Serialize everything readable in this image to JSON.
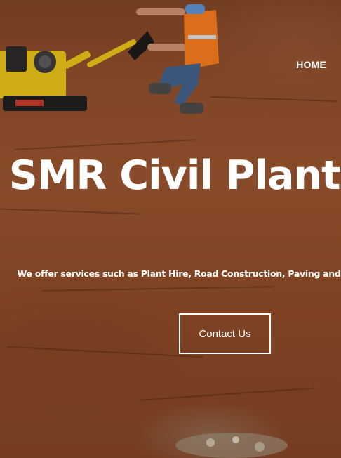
{
  "nav": {
    "home_label": "HOME"
  },
  "hero": {
    "title": "SMR Civil Plant Hire",
    "subtitle": "We offer services such as Plant Hire, Road Construction, Paving and many other services.",
    "cta_label": "Contact Us"
  },
  "colors": {
    "text": "#ffffff",
    "soil": "#8d4d2b",
    "machine": "#e5c21a",
    "vest": "#f07a1e"
  }
}
